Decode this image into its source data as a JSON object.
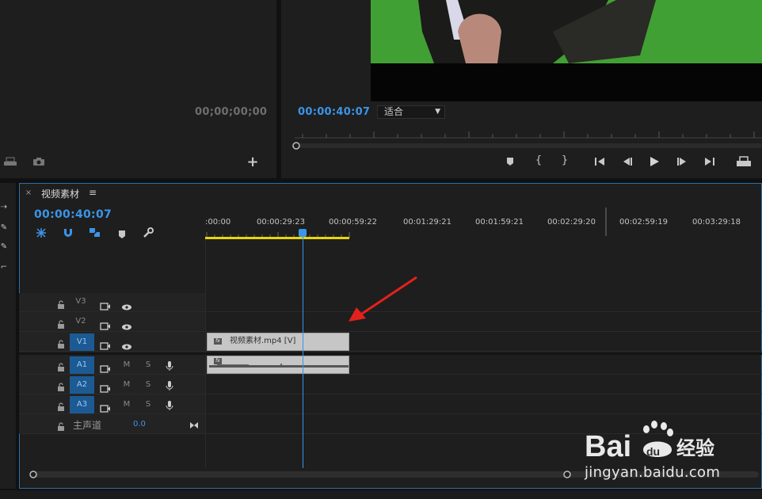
{
  "source_monitor": {
    "timecode": "00;00;00;00"
  },
  "program_monitor": {
    "timecode": "00:00:40:07",
    "fit_select": "适合"
  },
  "timeline": {
    "tab_title": "视频素材",
    "timecode": "00:00:40:07",
    "ruler_labels": [
      ":00:00",
      "00:00:29:23",
      "00:00:59:22",
      "00:01:29:21",
      "00:01:59:21",
      "00:02:29:20",
      "00:02:59:19",
      "00:03:29:18"
    ],
    "video_tracks": [
      "V3",
      "V2",
      "V1"
    ],
    "audio_tracks": [
      "A1",
      "A2",
      "A3"
    ],
    "mute_label": "M",
    "solo_label": "S",
    "master": {
      "label": "主声道",
      "value": "0.0"
    },
    "clip_video_label": "视频素材.mp4 [V]"
  },
  "watermark": {
    "brand": "Bai du 经验",
    "url": "jingyan.baidu.com"
  },
  "colors": {
    "accent": "#3b95e8",
    "work_area": "#e8d60a",
    "target": "#1c5a94",
    "arrow": "#e3211c"
  }
}
